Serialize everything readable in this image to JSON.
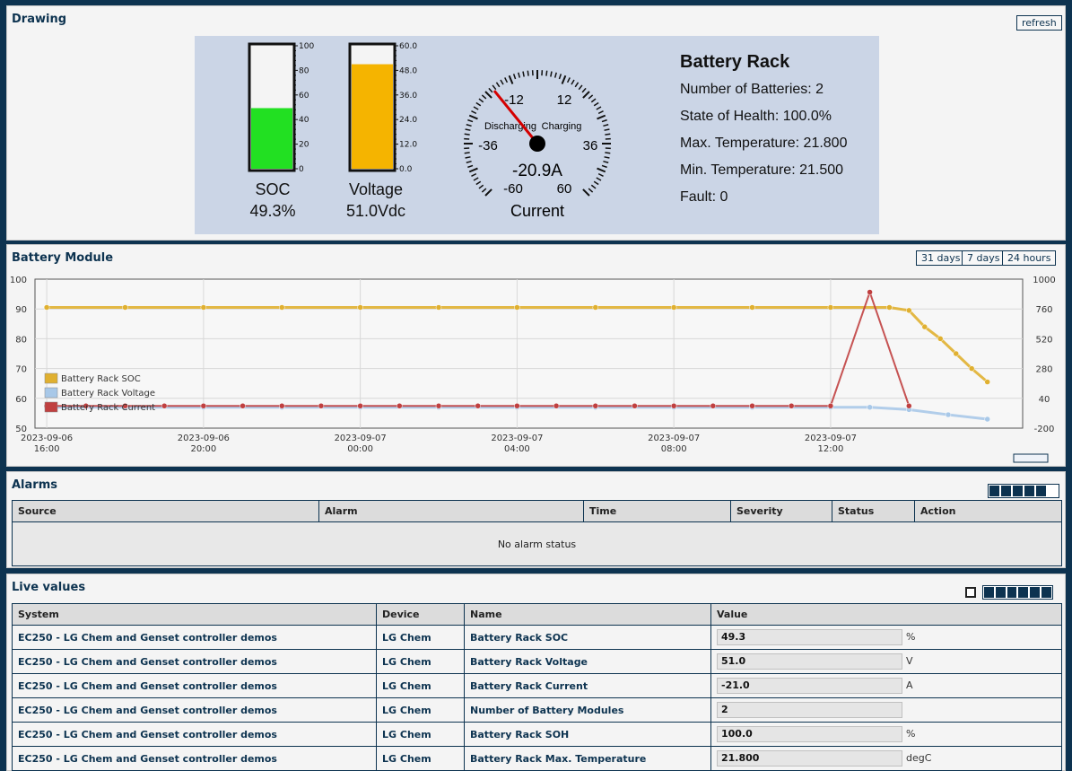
{
  "drawing": {
    "title": "Drawing",
    "refresh_label": "refresh",
    "soc": {
      "label": "SOC",
      "value_text": "49.3%",
      "level": 49.3,
      "max": 100,
      "ticks": [
        "100",
        "80",
        "60",
        "40",
        "20",
        "0"
      ],
      "color": "#22e022"
    },
    "voltage": {
      "label": "Voltage",
      "value_text": "51.0Vdc",
      "level": 51.0,
      "max": 60,
      "ticks": [
        "60.0",
        "48.0",
        "36.0",
        "24.0",
        "12.0",
        "0.0"
      ],
      "color": "#f5b400"
    },
    "current": {
      "label": "Current",
      "value_text": "-20.9A",
      "value": -20.9,
      "discharging_label": "Discharging",
      "charging_label": "Charging",
      "scale_labels": [
        "-12",
        "12",
        "-36",
        "36",
        "-60",
        "60"
      ]
    },
    "rack": {
      "title": "Battery Rack",
      "lines": [
        "Number of Batteries: 2",
        "State of Health: 100.0%",
        "Max. Temperature: 21.800",
        "Min. Temperature: 21.500",
        "Fault: 0"
      ]
    }
  },
  "module": {
    "title": "Battery Module",
    "ranges": [
      "31 days",
      "7 days",
      "24 hours"
    ]
  },
  "chart_data": {
    "type": "line",
    "x_ticks": [
      {
        "date": "2023-09-06",
        "time": "16:00"
      },
      {
        "date": "2023-09-06",
        "time": "20:00"
      },
      {
        "date": "2023-09-07",
        "time": "00:00"
      },
      {
        "date": "2023-09-07",
        "time": "04:00"
      },
      {
        "date": "2023-09-07",
        "time": "08:00"
      },
      {
        "date": "2023-09-07",
        "time": "12:00"
      }
    ],
    "y_left_ticks": [
      "100",
      "90",
      "80",
      "70",
      "60",
      "50"
    ],
    "y_right_ticks": [
      "1000",
      "760",
      "520",
      "280",
      "40",
      "-200"
    ],
    "ylim_left": [
      50,
      100
    ],
    "ylim_right": [
      -200,
      1000
    ],
    "grid": true,
    "legend_position": "bottom-left",
    "series": [
      {
        "name": "Battery Rack SOC",
        "color": "#e0b030",
        "axis": "left",
        "x_hours": [
          0,
          2,
          4,
          6,
          8,
          10,
          12,
          14,
          16,
          18,
          20,
          21.5,
          22,
          22.4,
          22.8,
          23.2,
          23.6,
          24
        ],
        "values": [
          90.5,
          90.5,
          90.5,
          90.5,
          90.5,
          90.5,
          90.5,
          90.5,
          90.5,
          90.5,
          90.5,
          90.5,
          89.5,
          84,
          80,
          75,
          70,
          65.5
        ]
      },
      {
        "name": "Battery Rack Voltage",
        "color": "#a8c8e8",
        "axis": "left",
        "x_hours": [
          0,
          2,
          4,
          6,
          8,
          10,
          12,
          14,
          16,
          18,
          20,
          21,
          22,
          23,
          24
        ],
        "values": [
          57,
          57,
          57,
          57,
          57,
          57,
          57,
          57,
          57,
          57,
          57,
          57,
          56.2,
          54.5,
          53
        ]
      },
      {
        "name": "Battery Rack Current",
        "color": "#c04040",
        "axis": "right",
        "x_hours": [
          0,
          1,
          2,
          3,
          4,
          5,
          6,
          7,
          8,
          9,
          10,
          11,
          12,
          13,
          14,
          15,
          16,
          17,
          18,
          19,
          20,
          21,
          22
        ],
        "values": [
          -21,
          -21,
          -21,
          -21,
          -21,
          -21,
          -21,
          -21,
          -21,
          -21,
          -21,
          -21,
          -21,
          -21,
          -21,
          -21,
          -21,
          -21,
          -21,
          -21,
          -21,
          895,
          -21
        ]
      }
    ]
  },
  "alarms": {
    "title": "Alarms",
    "columns": [
      "Source",
      "Alarm",
      "Time",
      "Severity",
      "Status",
      "Action"
    ],
    "empty_text": "No alarm status"
  },
  "live": {
    "title": "Live values",
    "columns": [
      "System",
      "Device",
      "Name",
      "Value"
    ],
    "rows": [
      {
        "system": "EC250 - LG Chem and Genset controller demos",
        "device": "LG Chem",
        "name": "Battery Rack SOC",
        "value": "49.3",
        "unit": "%"
      },
      {
        "system": "EC250 - LG Chem and Genset controller demos",
        "device": "LG Chem",
        "name": "Battery Rack Voltage",
        "value": "51.0",
        "unit": "V"
      },
      {
        "system": "EC250 - LG Chem and Genset controller demos",
        "device": "LG Chem",
        "name": "Battery Rack Current",
        "value": "-21.0",
        "unit": "A"
      },
      {
        "system": "EC250 - LG Chem and Genset controller demos",
        "device": "LG Chem",
        "name": "Number of Battery Modules",
        "value": "2",
        "unit": ""
      },
      {
        "system": "EC250 - LG Chem and Genset controller demos",
        "device": "LG Chem",
        "name": "Battery Rack SOH",
        "value": "100.0",
        "unit": "%"
      },
      {
        "system": "EC250 - LG Chem and Genset controller demos",
        "device": "LG Chem",
        "name": "Battery Rack Max. Temperature",
        "value": "21.800",
        "unit": "degC"
      }
    ]
  }
}
